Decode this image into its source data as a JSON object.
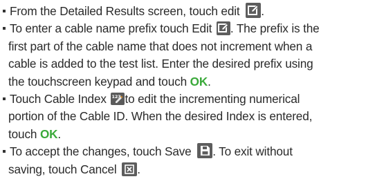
{
  "instructions": {
    "item1": {
      "text": "From the Detailed Results screen, touch edit",
      "trail": "."
    },
    "item2": {
      "pre": "To enter a cable name prefix touch Edit",
      "post": ". The prefix is the",
      "line2": "first part of the cable name that does not increment when a",
      "line3": "cable is added to the test list. Enter the desired prefix using",
      "line4_pre": "the touchscreen keypad and touch",
      "ok": "OK",
      "line4_post": "."
    },
    "item3": {
      "pre": "Touch Cable Index",
      "post": "to edit the incrementing numerical",
      "line2": "portion of the Cable ID. When the desired Index is entered,",
      "line3_pre": "touch",
      "ok": "OK",
      "line3_post": "."
    },
    "item4": {
      "pre": "To accept the changes, touch Save",
      "post": ". To exit without",
      "line2_pre": "saving, touch Cancel",
      "line2_post": "."
    }
  },
  "icons": {
    "edit": "edit-icon",
    "cable_index": "cable-index-icon",
    "save": "save-icon",
    "cancel": "cancel-icon"
  },
  "colors": {
    "ok_text": "#3aa93a",
    "icon_bg": "#5d5d5d"
  }
}
